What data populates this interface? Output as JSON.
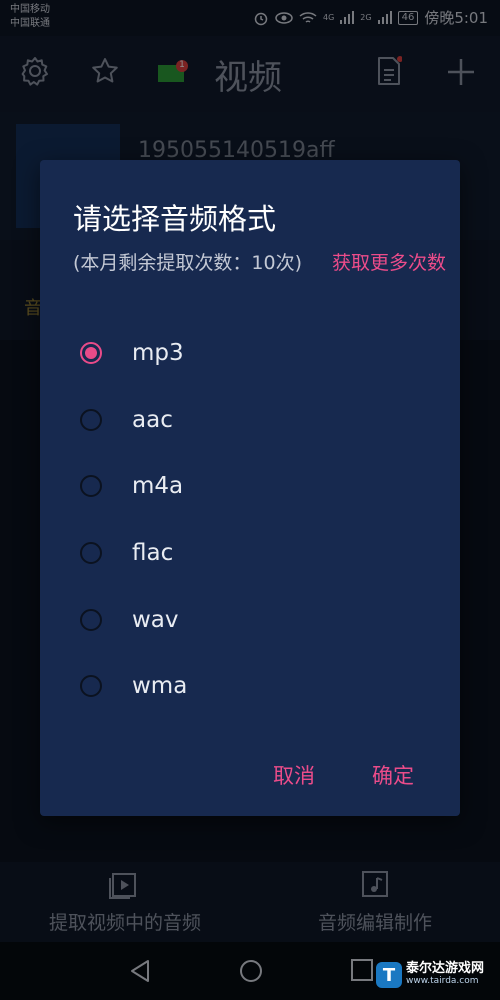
{
  "status_bar": {
    "carrier_1": "中国移动",
    "carrier_2": "中国联通",
    "network_1": "4G",
    "network_2": "2G",
    "battery": "46",
    "time": "傍晚5:01"
  },
  "app_bar": {
    "title": "视频",
    "notification_count": "1",
    "icons": [
      "gear-icon",
      "star-icon",
      "message-icon",
      "document-icon",
      "plus-icon"
    ]
  },
  "background": {
    "video_name": "195055140519aff",
    "tab_chip": "音"
  },
  "dialog": {
    "title": "请选择音频格式",
    "message": "(本月剩余提取次数：10次)",
    "link": "获取更多次数",
    "options": [
      {
        "label": "mp3",
        "selected": true
      },
      {
        "label": "aac",
        "selected": false
      },
      {
        "label": "m4a",
        "selected": false
      },
      {
        "label": "flac",
        "selected": false
      },
      {
        "label": "wav",
        "selected": false
      },
      {
        "label": "wma",
        "selected": false
      }
    ],
    "cancel_label": "取消",
    "confirm_label": "确定"
  },
  "bottom_bar": {
    "items": [
      {
        "label": "提取视频中的音频",
        "icon": "play-file-icon"
      },
      {
        "label": "音频编辑制作",
        "icon": "music-file-icon"
      }
    ]
  },
  "watermark": {
    "logo": "T",
    "name": "泰尔达游戏网",
    "url": "www.tairda.com"
  },
  "colors": {
    "accent": "#e94b89",
    "dialog_bg": "#17294f",
    "app_bg": "#111b2c"
  }
}
